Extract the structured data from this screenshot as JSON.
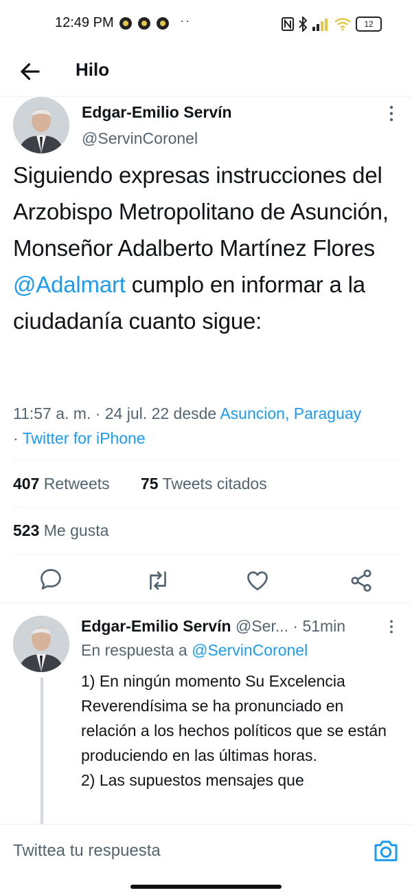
{
  "status_bar": {
    "time": "12:49 PM",
    "more": "··",
    "battery": "12"
  },
  "header": {
    "title": "Hilo"
  },
  "tweet": {
    "author_name": "Edgar-Emilio Servín",
    "author_handle": "@ServinCoronel",
    "text_before_mention": "Siguiendo expresas instrucciones del Arzobispo Metropolitano de Asunción, Monseñor Adalberto Martínez Flores ",
    "mention": "@Adalmart",
    "text_after_mention": " cumplo en informar a la ciudadanía cuanto sigue:",
    "time_date": "11:57 a. m. · 24 jul. 22 desde ",
    "location": "Asuncion, Paraguay",
    "separator": " · ",
    "client": "Twitter for iPhone",
    "retweets_count": "407",
    "retweets_label": "Retweets",
    "quotes_count": "75",
    "quotes_label": "Tweets citados",
    "likes_count": "523",
    "likes_label": "Me gusta"
  },
  "reply": {
    "author_name": "Edgar-Emilio Servín",
    "author_handle": "@Ser...",
    "time": "· 51min",
    "in_reply_prefix": "En respuesta a ",
    "in_reply_handle": "@ServinCoronel",
    "text_line1": "1) En ningún momento Su Excelencia Reverendísima se ha pronunciado en relación a los hechos políticos que se están produciendo en las últimas horas.",
    "text_line2": "2) Las supuestos mensajes que"
  },
  "compose": {
    "placeholder": "Twittea tu respuesta"
  },
  "colors": {
    "accent": "#1d9bf0",
    "secondary_text": "#536471",
    "primary_text": "#0f1419"
  },
  "icons": [
    "back-arrow-icon",
    "more-vertical-icon",
    "reply-icon",
    "retweet-icon",
    "like-icon",
    "share-icon",
    "camera-icon"
  ]
}
